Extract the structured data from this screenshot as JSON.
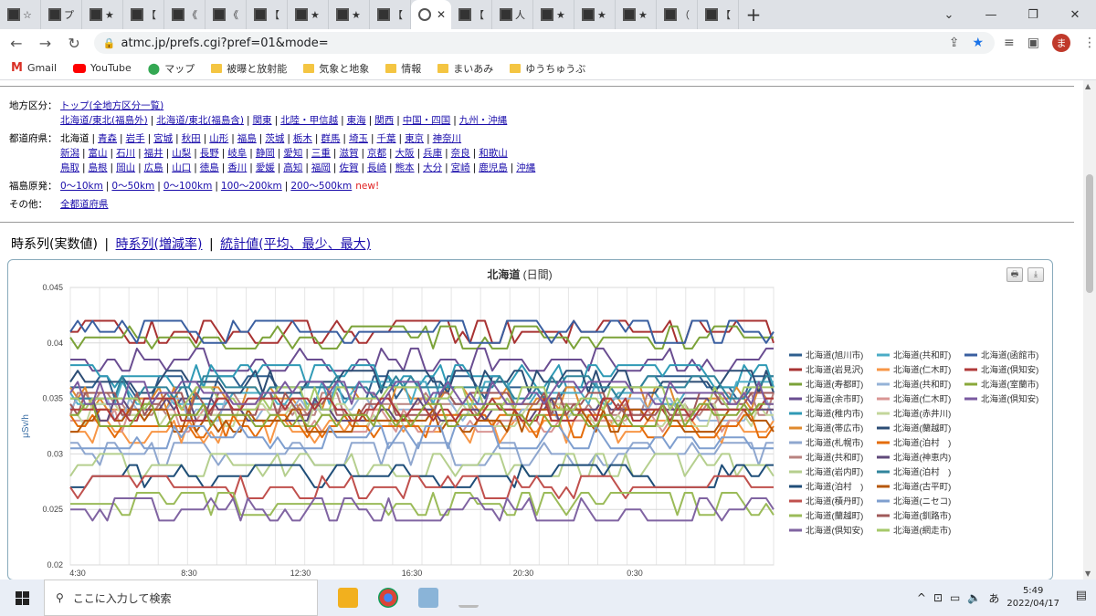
{
  "browser": {
    "tabs": [
      {
        "label": "☆"
      },
      {
        "label": "プ"
      },
      {
        "label": "★"
      },
      {
        "label": "【"
      },
      {
        "label": "《"
      },
      {
        "label": "《"
      },
      {
        "label": "【"
      },
      {
        "label": "★"
      },
      {
        "label": "★"
      },
      {
        "label": "【"
      },
      {
        "label": "",
        "active": true
      },
      {
        "label": "【"
      },
      {
        "label": "人"
      },
      {
        "label": "★"
      },
      {
        "label": "★"
      },
      {
        "label": "★"
      },
      {
        "label": "（"
      },
      {
        "label": "【"
      }
    ],
    "url": "atmc.jp/prefs.cgi?pref=01&mode=",
    "avatar_letter": "ま",
    "bookmarks": [
      {
        "label": "Gmail",
        "icon": "gmail-icon"
      },
      {
        "label": "YouTube",
        "icon": "youtube-icon"
      },
      {
        "label": "マップ",
        "icon": "maps-icon"
      },
      {
        "label": "被曝と放射能",
        "icon": "folder-icon"
      },
      {
        "label": "気象と地象",
        "icon": "folder-icon"
      },
      {
        "label": "情報",
        "icon": "folder-icon"
      },
      {
        "label": "まいあみ",
        "icon": "folder-icon"
      },
      {
        "label": "ゆうちゅうぶ",
        "icon": "folder-icon"
      }
    ]
  },
  "nav": {
    "region_label": "地方区分：",
    "region_top": "トップ(全地方区分一覧)",
    "regions": [
      "北海道/東北(福島外)",
      "北海道/東北(福島含)",
      "関東",
      "北陸・甲信越",
      "東海",
      "関西",
      "中国・四国",
      "九州・沖縄"
    ],
    "pref_label": "都道府県：",
    "pref_current": "北海道",
    "prefs_row1": [
      "青森",
      "岩手",
      "宮城",
      "秋田",
      "山形",
      "福島",
      "茨城",
      "栃木",
      "群馬",
      "埼玉",
      "千葉",
      "東京",
      "神奈川"
    ],
    "prefs_row2": [
      "新潟",
      "富山",
      "石川",
      "福井",
      "山梨",
      "長野",
      "岐阜",
      "静岡",
      "愛知",
      "三重",
      "滋賀",
      "京都",
      "大阪",
      "兵庫",
      "奈良",
      "和歌山"
    ],
    "prefs_row3": [
      "鳥取",
      "島根",
      "岡山",
      "広島",
      "山口",
      "徳島",
      "香川",
      "愛媛",
      "高知",
      "福岡",
      "佐賀",
      "長崎",
      "熊本",
      "大分",
      "宮崎",
      "鹿児島",
      "沖縄"
    ],
    "fukushima_label": "福島原発：",
    "fukushima_ranges": [
      "0～10km",
      "0～50km",
      "0～100km",
      "100～200km",
      "200～500km"
    ],
    "new_flag": "new!",
    "other_label": "その他：",
    "other_link": "全都道府県"
  },
  "modes": {
    "current": "時系列(実数値)",
    "links": [
      "時系列(増減率)",
      "統計値(平均、最少、最大)"
    ]
  },
  "chart_data": {
    "type": "line",
    "title": "北海道",
    "subtitle": "(日間)",
    "ylabel": "μSv/h",
    "xlabel": "",
    "ylim": [
      0.02,
      0.045
    ],
    "yticks": [
      "0.02",
      "0.025",
      "0.03",
      "0.035",
      "0.04",
      "0.045"
    ],
    "xticks": [
      "4:30",
      "8:30",
      "12:30",
      "16:30",
      "20:30",
      "0:30"
    ],
    "grid": true,
    "legend_position": "right",
    "series": [
      {
        "name": "北海道(旭川市)",
        "color": "#2e5f8f",
        "base": 0.036
      },
      {
        "name": "北海道(岩見沢)",
        "color": "#a83232",
        "base": 0.041
      },
      {
        "name": "北海道(寿都町)",
        "color": "#7ba238",
        "base": 0.0405
      },
      {
        "name": "北海道(余市町)",
        "color": "#6a4d91",
        "base": 0.0385
      },
      {
        "name": "北海道(稚内市)",
        "color": "#2f9ab5",
        "base": 0.037
      },
      {
        "name": "北海道(帯広市)",
        "color": "#e08a2e",
        "base": 0.035
      },
      {
        "name": "北海道(札幌市)",
        "color": "#8fa7cf",
        "base": 0.03
      },
      {
        "name": "北海道(共和町)",
        "color": "#b98380",
        "base": 0.0345
      },
      {
        "name": "北海道(岩内町)",
        "color": "#b5cf8e",
        "base": 0.029
      },
      {
        "name": "北海道(泊村　)",
        "color": "#1f4e79",
        "base": 0.028
      },
      {
        "name": "北海道(積丹町)",
        "color": "#c0504d",
        "base": 0.027
      },
      {
        "name": "北海道(蘭越町)",
        "color": "#9bbb59",
        "base": 0.0255
      },
      {
        "name": "北海道(倶知安)",
        "color": "#8064a2",
        "base": 0.025
      },
      {
        "name": "北海道(共和町)",
        "color": "#4bacc6",
        "base": 0.0355
      },
      {
        "name": "北海道(仁木町)",
        "color": "#f79646",
        "base": 0.032
      },
      {
        "name": "北海道(共和町)",
        "color": "#95b3d7",
        "base": 0.034
      },
      {
        "name": "北海道(仁木町)",
        "color": "#d99694",
        "base": 0.033
      },
      {
        "name": "北海道(赤井川)",
        "color": "#c3d69b",
        "base": 0.0335
      },
      {
        "name": "北海道(蘭越町)",
        "color": "#2c4d75",
        "base": 0.0365
      },
      {
        "name": "北海道(泊村　)",
        "color": "#e46c0a",
        "base": 0.0325
      },
      {
        "name": "北海道(神恵内)",
        "color": "#604a7b",
        "base": 0.034
      },
      {
        "name": "北海道(泊村　)",
        "color": "#31859c",
        "base": 0.036
      },
      {
        "name": "北海道(古平町)",
        "color": "#b65708",
        "base": 0.033
      },
      {
        "name": "北海道(ニセコ)",
        "color": "#7f9fcf",
        "base": 0.0315
      },
      {
        "name": "北海道(釧路市)",
        "color": "#a05a5a",
        "base": 0.0345
      },
      {
        "name": "北海道(網走市)",
        "color": "#a6c96a",
        "base": 0.035
      },
      {
        "name": "北海道(函館市)",
        "color": "#3a5fa0",
        "base": 0.041
      },
      {
        "name": "北海道(倶知安)",
        "color": "#b03a3a",
        "base": 0.034
      },
      {
        "name": "北海道(室蘭市)",
        "color": "#8aa83a",
        "base": 0.0335
      },
      {
        "name": "北海道(倶知安)",
        "color": "#7a5aa0",
        "base": 0.0355
      }
    ]
  },
  "taskbar": {
    "search_placeholder": "ここに入力して検索",
    "time": "5:49",
    "date": "2022/04/17",
    "ime": "あ"
  }
}
